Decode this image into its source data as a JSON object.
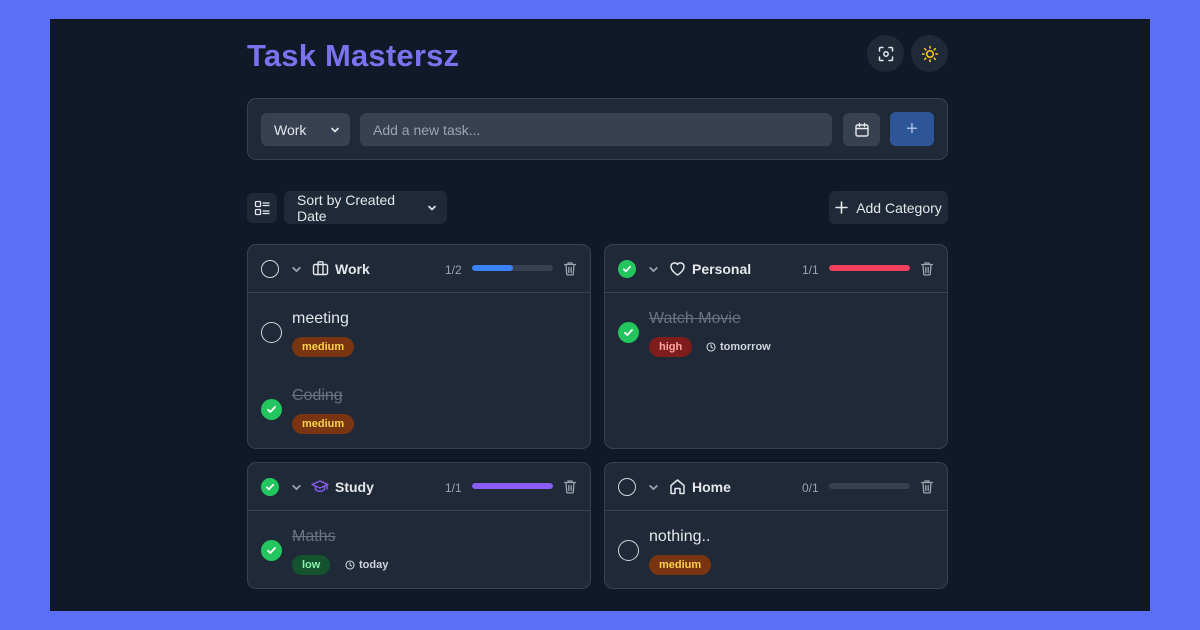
{
  "app": {
    "title": "Task Mastersz",
    "header_icons": [
      "scan-icon",
      "sun-icon"
    ]
  },
  "add_task": {
    "category_value": "Work",
    "input_placeholder": "Add a new task...",
    "input_value": "",
    "calendar_icon": "calendar-icon",
    "add_icon": "plus-icon",
    "add_label": "+"
  },
  "toolbar": {
    "view_icon": "list-view-icon",
    "sort_value": "Sort by Created Date",
    "add_category_label": "Add Category",
    "add_category_icon": "plus-icon"
  },
  "colors": {
    "work": "#3b82f6",
    "personal": "#f43f5e",
    "study": "#8b5cf6",
    "home": "#6b7280",
    "done": "#22c55e"
  },
  "categories": [
    {
      "name": "Work",
      "icon": "briefcase-icon",
      "count": "1/2",
      "progress": 0.5,
      "completed": false,
      "tasks": [
        {
          "title": "meeting",
          "priority": "medium",
          "due": "",
          "done": false
        },
        {
          "title": "Coding",
          "priority": "medium",
          "due": "",
          "done": true
        }
      ]
    },
    {
      "name": "Personal",
      "icon": "heart-icon",
      "count": "1/1",
      "progress": 1,
      "completed": true,
      "tasks": [
        {
          "title": "Watch Movie",
          "priority": "high",
          "due": "tomorrow",
          "done": true
        }
      ]
    },
    {
      "name": "Study",
      "icon": "graduation-cap-icon",
      "count": "1/1",
      "progress": 1,
      "completed": true,
      "tasks": [
        {
          "title": "Maths",
          "priority": "low",
          "due": "today",
          "done": true
        }
      ]
    },
    {
      "name": "Home",
      "icon": "house-icon",
      "count": "0/1",
      "progress": 0,
      "completed": false,
      "tasks": [
        {
          "title": "nothing..",
          "priority": "medium",
          "due": "",
          "done": false
        }
      ]
    }
  ]
}
